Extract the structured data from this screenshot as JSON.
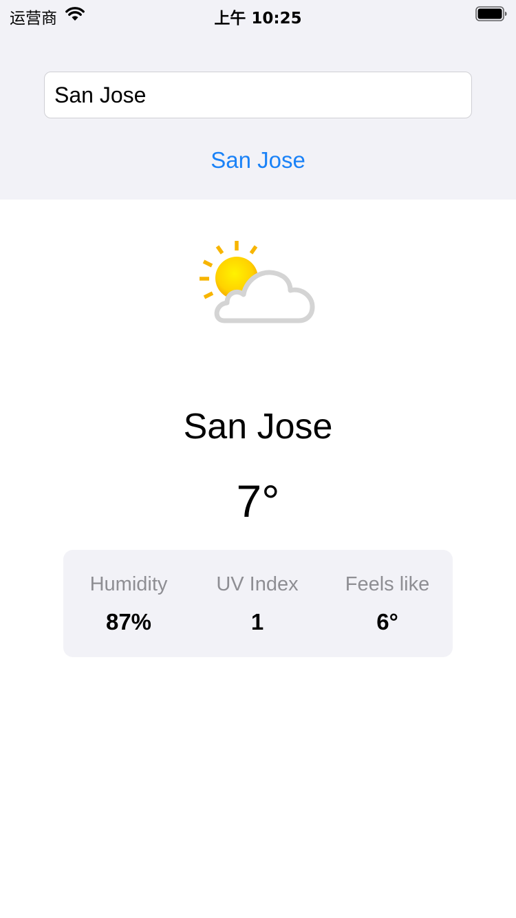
{
  "status_bar": {
    "carrier": "运营商",
    "time": "上午 10:25",
    "wifi_icon": "wifi-icon",
    "battery_icon": "battery-icon"
  },
  "search": {
    "value": "San Jose",
    "suggestion": "San Jose"
  },
  "weather": {
    "icon": "partly-cloudy-icon",
    "city": "San Jose",
    "temperature": "7°"
  },
  "stats": [
    {
      "label": "Humidity",
      "value": "87%"
    },
    {
      "label": "UV Index",
      "value": "1"
    },
    {
      "label": "Feels like",
      "value": "6°"
    }
  ],
  "colors": {
    "accent": "#1a82f7",
    "panel_bg": "#f2f2f7",
    "secondary_text": "#8e8e93",
    "sun": "#ffd200",
    "cloud": "#d9d9d9"
  }
}
